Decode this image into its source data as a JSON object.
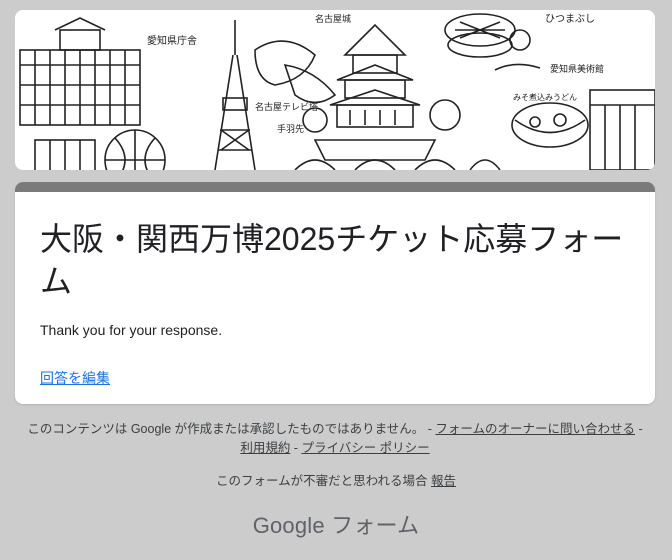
{
  "form": {
    "title": "大阪・関西万博2025チケット応募フォーム",
    "response_message": "Thank you for your response.",
    "edit_link": "回答を編集"
  },
  "banner": {
    "labels": [
      "愛知県庁舎",
      "名古屋城",
      "ひつまぶし",
      "愛知県美術館",
      "名古屋テレビ塔",
      "手羽先",
      "みそ煮込みうどん"
    ]
  },
  "footer": {
    "disclaimer": "このコンテンツは Google が作成または承認したものではありません。",
    "sep1": " - ",
    "contact_owner": "フォームのオーナーに問い合わせる",
    "sep2": " - ",
    "terms": "利用規約",
    "sep3": " - ",
    "privacy": "プライバシー ポリシー",
    "report_prefix": "このフォームが不審だと思われる場合 ",
    "report_link": "報告",
    "brand_google": "Google",
    "brand_forms": " フォーム"
  },
  "colors": {
    "background": "#cccccc",
    "card_accent": "#7a7a7a",
    "link": "#1a73e8"
  }
}
